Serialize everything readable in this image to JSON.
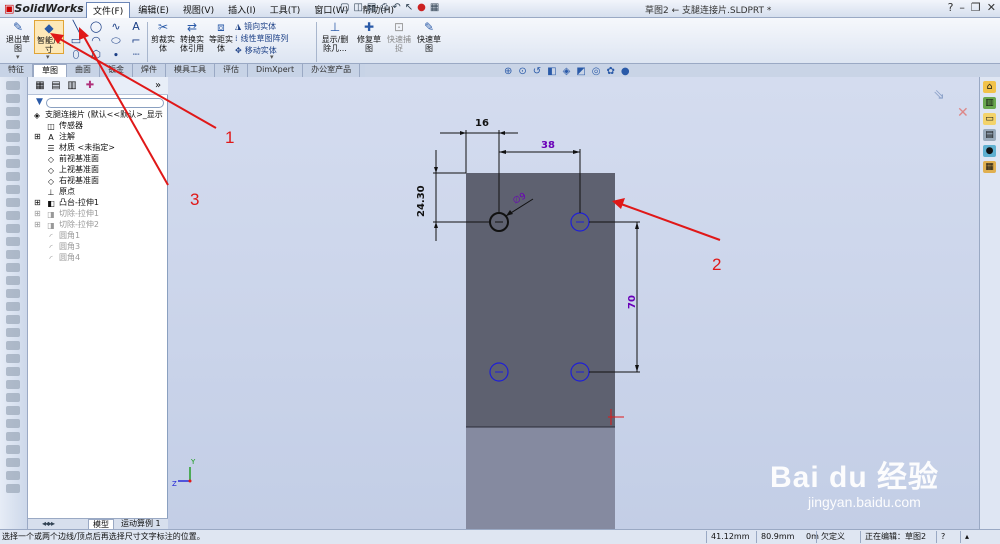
{
  "app": {
    "logo": "SolidWorks",
    "document_title": "草图2 ← 支腿连接片.SLDPRT *",
    "menu": [
      "文件(F)",
      "编辑(E)",
      "视图(V)",
      "插入(I)",
      "工具(T)",
      "窗口(W)",
      "帮助(H)"
    ]
  },
  "ribbon": {
    "exit_sketch": "退出草图",
    "smart_dimension": "智能尺寸",
    "trim": "剪裁实体",
    "convert": "转换实体引用",
    "offset": "等距实体",
    "mirror": "镜向实体",
    "linear_pattern": "线性草图阵列",
    "move": "移动实体",
    "display_delete": "显示/删除几...",
    "repair": "修复草图",
    "quick_snaps": "快速捕捉",
    "rapid_sketch": "快速草图"
  },
  "tabs": [
    "特征",
    "草图",
    "曲面",
    "钣金",
    "焊件",
    "模具工具",
    "评估",
    "DimXpert",
    "办公室产品"
  ],
  "tabs_active": "草图",
  "tree": [
    {
      "label": "支腿连接片  (默认<<默认>_显示",
      "icon": "part-icon",
      "dim": false,
      "indent": 0
    },
    {
      "label": "传感器",
      "icon": "sensor-icon",
      "dim": false,
      "indent": 1
    },
    {
      "label": "注解",
      "icon": "annotation-icon",
      "dim": false,
      "indent": 1
    },
    {
      "label": "材质 <未指定>",
      "icon": "material-icon",
      "dim": false,
      "indent": 1
    },
    {
      "label": "前视基准面",
      "icon": "plane-icon",
      "dim": false,
      "indent": 1
    },
    {
      "label": "上视基准面",
      "icon": "plane-icon",
      "dim": false,
      "indent": 1
    },
    {
      "label": "右视基准面",
      "icon": "plane-icon",
      "dim": false,
      "indent": 1
    },
    {
      "label": "原点",
      "icon": "origin-icon",
      "dim": false,
      "indent": 1
    },
    {
      "label": "凸台-拉伸1",
      "icon": "boss-extrude-icon",
      "dim": false,
      "indent": 1
    },
    {
      "label": "切除-拉伸1",
      "icon": "cut-extrude-icon",
      "dim": true,
      "indent": 1
    },
    {
      "label": "切除-拉伸2",
      "icon": "cut-extrude-icon",
      "dim": true,
      "indent": 1
    },
    {
      "label": "圆角1",
      "icon": "fillet-icon",
      "dim": true,
      "indent": 1
    },
    {
      "label": "圆角3",
      "icon": "fillet-icon",
      "dim": true,
      "indent": 1
    },
    {
      "label": "圆角4",
      "icon": "fillet-icon",
      "dim": true,
      "indent": 1
    }
  ],
  "bottom_tabs": {
    "model": "模型",
    "motion": "运动算例 1"
  },
  "dimensions": {
    "d16": "16",
    "d38": "38",
    "d24": "24.30",
    "d70": "70",
    "dia": "∅9"
  },
  "annotations": [
    "1",
    "2",
    "3"
  ],
  "watermark": {
    "main": "Bai du 经验",
    "sub": "jingyan.baidu.com"
  },
  "status": {
    "message": "选择一个或两个边线/顶点后再选择尺寸文字标注的位置。",
    "x": "41.12mm",
    "y": "80.9mm",
    "z": "0m",
    "state": "欠定义",
    "editing": "正在编辑：草图2"
  },
  "colors": {
    "part_face": "#5e6170",
    "part_lower": "#858aa0",
    "hole_blue": "#1f1fd6",
    "selected_hole": "#111111",
    "annotation_red": "#e01818",
    "dimension_purple": "#6a00b8"
  }
}
